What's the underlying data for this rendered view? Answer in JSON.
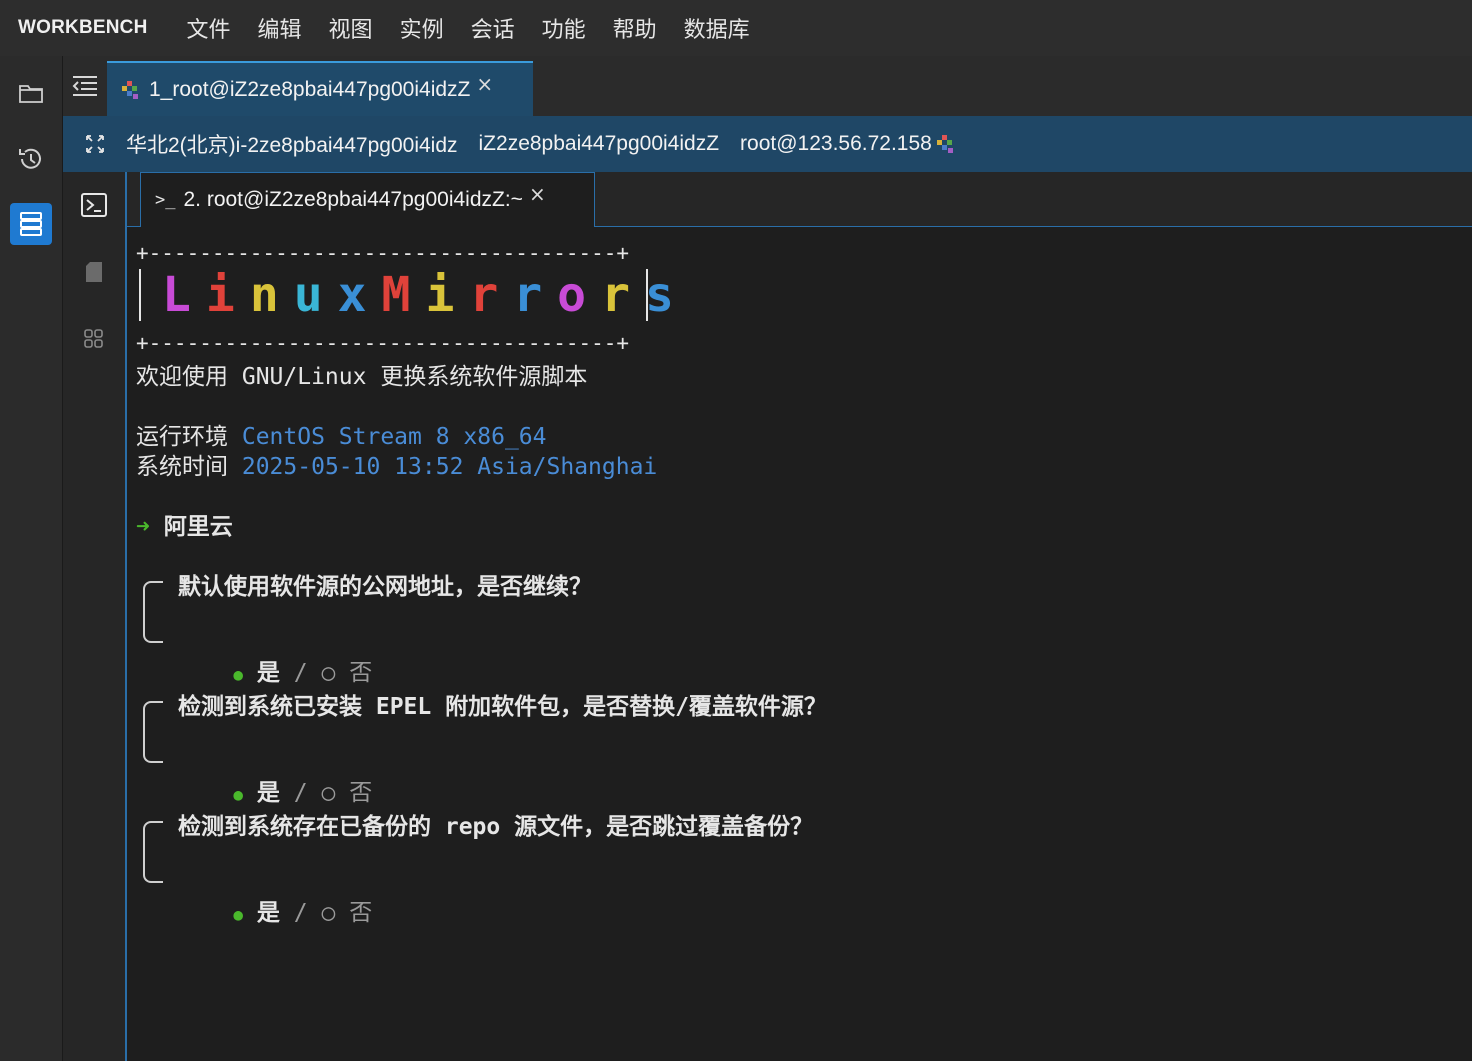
{
  "menubar": {
    "brand": "WORKBENCH",
    "items": [
      "文件",
      "编辑",
      "视图",
      "实例",
      "会话",
      "功能",
      "帮助",
      "数据库"
    ]
  },
  "session_tab": {
    "label": "1_root@iZ2ze8pbai447pg00i4idzZ",
    "close": "×"
  },
  "infobar": {
    "region": "华北2(北京)i-2ze8pbai447pg00i4idz",
    "hostname": "iZ2ze8pbai447pg00i4idzZ",
    "login": "root@123.56.72.158"
  },
  "terminal_tab": {
    "prompt_icon": ">_",
    "label": "2. root@iZ2ze8pbai447pg00i4idzZ:~",
    "close": "×"
  },
  "terminal": {
    "banner_border": "+-------------------------------------+",
    "banner_logo": "LinuxMirrors",
    "welcome": "欢迎使用 GNU/Linux 更换系统软件源脚本",
    "env_label": "运行环境",
    "env_value": "CentOS Stream 8 x86_64",
    "time_label": "系统时间",
    "time_value": "2025-05-10 13:52 Asia/Shanghai",
    "arrow": "➜",
    "mirror": "阿里云",
    "questions": [
      {
        "text": "默认使用软件源的公网地址，是否继续？",
        "yes": "是",
        "sep": "/",
        "no": "否"
      },
      {
        "text": "检测到系统已安装 EPEL 附加软件包，是否替换/覆盖软件源？",
        "yes": "是",
        "sep": "/",
        "no": "否"
      },
      {
        "text": "检测到系统存在已备份的 repo 源文件，是否跳过覆盖备份？",
        "yes": "是",
        "sep": "/",
        "no": "否"
      }
    ]
  },
  "colors": {
    "accent": "#1f7ad1",
    "info_bar": "#1f4766",
    "terminal_blue": "#4a8cd6",
    "terminal_green": "#4ab82c"
  },
  "icons": {
    "activity": [
      "folder-icon",
      "history-icon",
      "server-list-icon"
    ],
    "side": [
      "terminal-icon",
      "file-icon",
      "grid-icon"
    ],
    "tabbar": [
      "collapse-menu-icon",
      "session-color-icon",
      "fullscreen-icon"
    ]
  }
}
